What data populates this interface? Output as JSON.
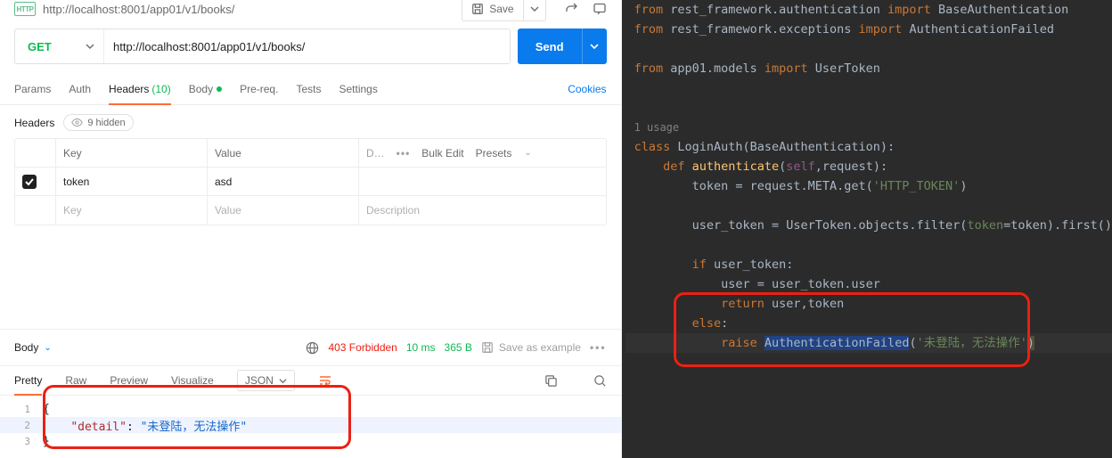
{
  "topbar": {
    "title_url": "http://localhost:8001/app01/v1/books/",
    "save_label": "Save"
  },
  "request": {
    "method": "GET",
    "url": "http://localhost:8001/app01/v1/books/",
    "send_label": "Send"
  },
  "tabs": {
    "params": "Params",
    "auth": "Auth",
    "headers": "Headers",
    "headers_count": "(10)",
    "body": "Body",
    "prereq": "Pre-req.",
    "tests": "Tests",
    "settings": "Settings",
    "cookies": "Cookies"
  },
  "headers_section": {
    "label": "Headers",
    "hidden_label": "9 hidden",
    "col_key": "Key",
    "col_value": "Value",
    "col_desc": "D…",
    "bulk_edit": "Bulk Edit",
    "presets": "Presets",
    "rows": [
      {
        "enabled": true,
        "key": "token",
        "value": "asd",
        "desc": ""
      }
    ],
    "placeholder_key": "Key",
    "placeholder_value": "Value",
    "placeholder_desc": "Description"
  },
  "response": {
    "body_label": "Body",
    "status_code": "403 Forbidden",
    "time": "10 ms",
    "size": "365 B",
    "save_example": "Save as example",
    "view_tabs": {
      "pretty": "Pretty",
      "raw": "Raw",
      "preview": "Preview",
      "visualize": "Visualize",
      "json": "JSON"
    },
    "body_json": {
      "lines": [
        {
          "n": "1",
          "text_prefix": "{",
          "key": "",
          "val": ""
        },
        {
          "n": "2",
          "text_prefix": "    ",
          "key": "\"detail\"",
          "colon": ": ",
          "val": "\"未登陆，无法操作\""
        },
        {
          "n": "3",
          "text_prefix": "}",
          "key": "",
          "val": ""
        }
      ]
    }
  },
  "editor": {
    "lines": [
      {
        "t": "from rest_framework.authentication import BaseAuthentication",
        "style": "import"
      },
      {
        "t": "from rest_framework.exceptions import AuthenticationFailed",
        "style": "import"
      },
      {
        "t": "",
        "style": "blank"
      },
      {
        "t": "from app01.models import UserToken",
        "style": "import"
      },
      {
        "t": "",
        "style": "blank"
      },
      {
        "t": "",
        "style": "blank"
      },
      {
        "t": "1 usage",
        "style": "usage"
      },
      {
        "t": "class LoginAuth(BaseAuthentication):",
        "style": "class"
      },
      {
        "t": "    def authenticate(self,request):",
        "style": "def"
      },
      {
        "t": "        token = request.META.get('HTTP_TOKEN')",
        "style": "body"
      },
      {
        "t": "",
        "style": "blank"
      },
      {
        "t": "        user_token = UserToken.objects.filter(token=token).first()",
        "style": "filter"
      },
      {
        "t": "",
        "style": "blank"
      },
      {
        "t": "        if user_token:",
        "style": "if"
      },
      {
        "t": "            user = user_token.user",
        "style": "bodyplain"
      },
      {
        "t": "            return user,token",
        "style": "return"
      },
      {
        "t": "        else:",
        "style": "else"
      },
      {
        "t": "            raise AuthenticationFailed('未登陆，无法操作')",
        "style": "raise"
      }
    ]
  }
}
